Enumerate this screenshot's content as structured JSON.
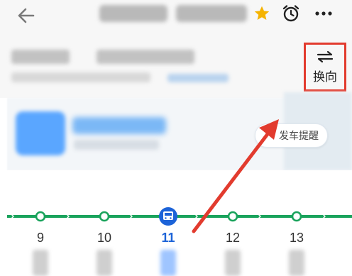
{
  "header": {
    "star_color": "#f5b300",
    "icons": [
      "back-arrow-icon",
      "star-icon",
      "alarm-clock-icon",
      "more-icon"
    ]
  },
  "reverse": {
    "label": "换向",
    "icon": "swap-arrows-icon",
    "highlight_color": "#e23b2e"
  },
  "alert": {
    "label": "发车提醒"
  },
  "route": {
    "line_color": "#1aa35c",
    "current_color": "#1c63d8",
    "stops": [
      {
        "num": "9",
        "current": false
      },
      {
        "num": "10",
        "current": false
      },
      {
        "num": "11",
        "current": true
      },
      {
        "num": "12",
        "current": false
      },
      {
        "num": "13",
        "current": false
      }
    ]
  },
  "annotation": {
    "arrow_color": "#e23b2e"
  }
}
